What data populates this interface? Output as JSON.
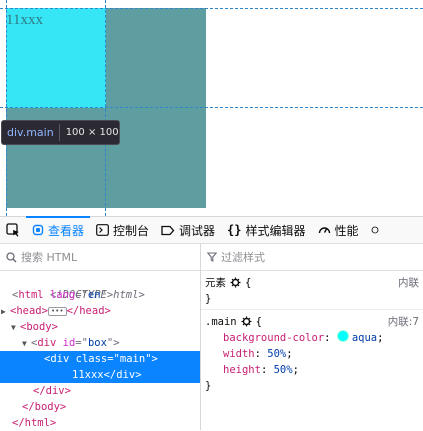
{
  "viewport": {
    "main_text": "11xxx",
    "tooltip": {
      "tag": "div.main",
      "dims": "100 × 100"
    },
    "colors": {
      "main": "#36e6f4",
      "box": "#5f9ea0"
    }
  },
  "toolbar": {
    "tabs": [
      {
        "label": "查看器",
        "icon": "inspector-icon",
        "active": true
      },
      {
        "label": "控制台",
        "icon": "console-icon"
      },
      {
        "label": "调试器",
        "icon": "debugger-icon"
      },
      {
        "label": "样式编辑器",
        "icon": "style-editor-icon"
      },
      {
        "label": "性能",
        "icon": "performance-icon"
      }
    ]
  },
  "html_panel": {
    "search_placeholder": "搜索 HTML",
    "doctype": "<!DOCTYPE html>",
    "html_open": {
      "tag": "html",
      "attr": "lang",
      "val": "en"
    },
    "head_open": "<head>",
    "head_close": "</head>",
    "body_open": "<body>",
    "div_box": {
      "tag": "div",
      "attr": "id",
      "val": "box"
    },
    "div_main": {
      "tag": "div",
      "attr": "class",
      "val": "main",
      "text": "11xxx"
    },
    "div_close": "</div>",
    "body_close": "</body>",
    "html_close": "</html>"
  },
  "rules_panel": {
    "filter_placeholder": "过滤样式",
    "element_rule": {
      "selector": "元素",
      "source": "内联",
      "open": "{",
      "close": "}"
    },
    "main_rule": {
      "selector": ".main",
      "source": "内联:7",
      "open": "{",
      "close": "}",
      "declarations": [
        {
          "prop": "background-color",
          "value": "aqua",
          "swatch": "#00ffff"
        },
        {
          "prop": "width",
          "value": "50%"
        },
        {
          "prop": "height",
          "value": "50%"
        }
      ]
    }
  }
}
